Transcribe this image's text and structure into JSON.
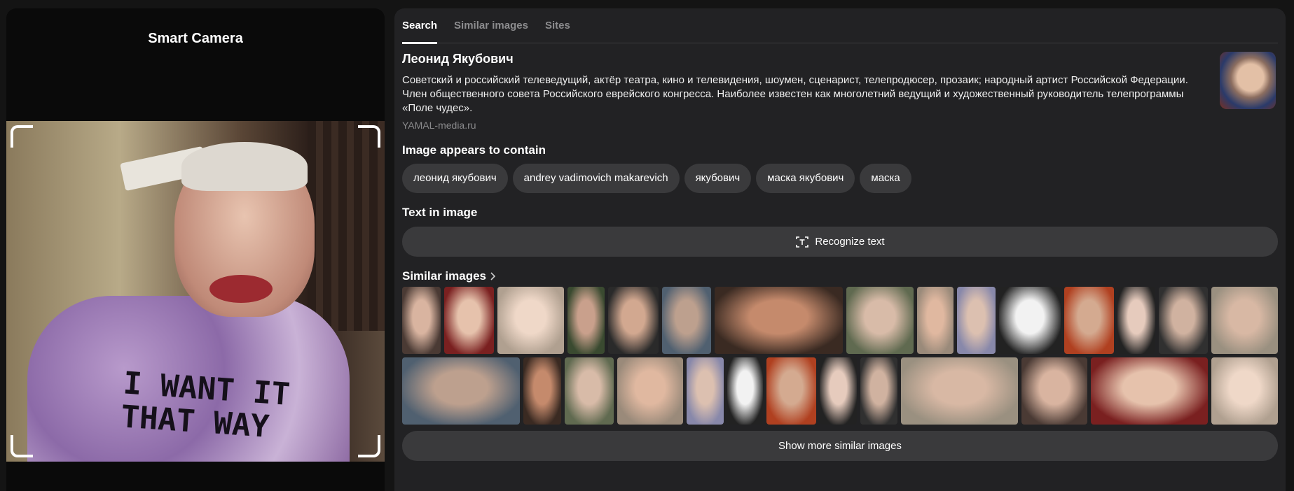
{
  "camera": {
    "title": "Smart Camera",
    "shirt_text": "I WANT IT\nTHAT WAY"
  },
  "tabs": [
    {
      "label": "Search",
      "active": true
    },
    {
      "label": "Similar images",
      "active": false
    },
    {
      "label": "Sites",
      "active": false
    }
  ],
  "entity": {
    "name": "Леонид Якубович",
    "description": "Советский и российский телеведущий, актёр театра, кино и телевидения, шоумен, сценарист, телепродюсер, прозаик; народный артист Российской Федерации. Член общественного совета Российского еврейского конгресса. Наиболее известен как многолетний ведущий и художественный руководитель телепрограммы «Поле чудес».",
    "source": "YAMAL-media.ru"
  },
  "contains": {
    "heading": "Image appears to contain",
    "tags": [
      "леонид якубович",
      "andrey vadimovich makarevich",
      "якубович",
      "маска якубович",
      "маска"
    ]
  },
  "text_in_image": {
    "heading": "Text in image",
    "button": "Recognize text",
    "icon": "text-recognition-icon"
  },
  "similar": {
    "heading": "Similar images",
    "show_more": "Show more similar images"
  },
  "colors": {
    "panel": "#222224",
    "chip": "#3a3a3c",
    "page": "#141414"
  }
}
